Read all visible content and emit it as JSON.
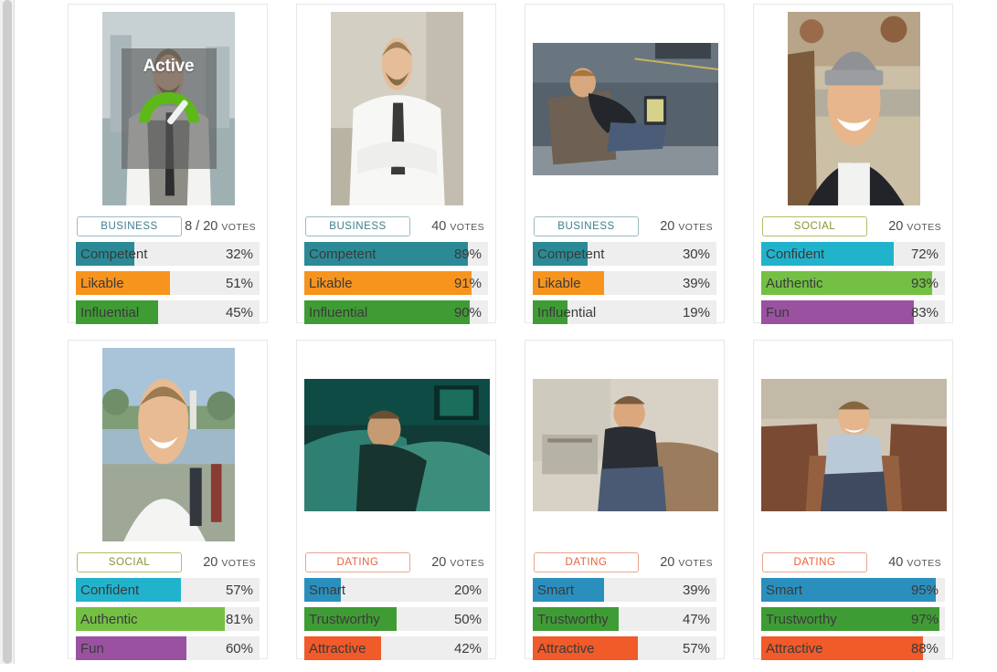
{
  "colors": {
    "business_trait_1": "#2b8a96",
    "business_trait_2": "#f7941e",
    "business_trait_3": "#3f9c35",
    "social_trait_1": "#22b3cc",
    "social_trait_2": "#74c044",
    "social_trait_3": "#9a52a0",
    "dating_trait_1": "#2b8fbd",
    "dating_trait_2": "#3f9c35",
    "dating_trait_3": "#f15a29",
    "track": "#eeeeee",
    "card_border": "#e8e8e8",
    "badge_business": "#3d7f8e",
    "badge_social": "#8a9430",
    "badge_dating": "#e8603c",
    "gauge_arc": "#5cb917",
    "overlay": "rgba(90,90,90,0.62)"
  },
  "cards": [
    {
      "photo": "man-in-vest-and-tie-city-background",
      "orientation": "portrait",
      "active": {
        "label": "Active",
        "icon": "gauge-icon"
      },
      "category": "BUSINESS",
      "category_class": "badge-business",
      "votes": "8 / 20",
      "votes_word": "VOTES",
      "traits": [
        {
          "name": "Competent",
          "pct": 32,
          "value": "32%",
          "color": "#2b8a96"
        },
        {
          "name": "Likable",
          "pct": 51,
          "value": "51%",
          "color": "#f7941e"
        },
        {
          "name": "Influential",
          "pct": 45,
          "value": "45%",
          "color": "#3f9c35"
        }
      ]
    },
    {
      "photo": "man-arms-crossed-white-shirt-tie",
      "orientation": "portrait",
      "active": null,
      "category": "BUSINESS",
      "category_class": "badge-business",
      "votes": "40",
      "votes_word": "VOTES",
      "traits": [
        {
          "name": "Competent",
          "pct": 89,
          "value": "89%",
          "color": "#2b8a96"
        },
        {
          "name": "Likable",
          "pct": 91,
          "value": "91%",
          "color": "#f7941e"
        },
        {
          "name": "Influential",
          "pct": 90,
          "value": "90%",
          "color": "#3f9c35"
        }
      ]
    },
    {
      "photo": "man-on-bench-with-laptop-outdoors",
      "orientation": "landscape",
      "active": null,
      "category": "BUSINESS",
      "category_class": "badge-business",
      "votes": "20",
      "votes_word": "VOTES",
      "traits": [
        {
          "name": "Competent",
          "pct": 30,
          "value": "30%",
          "color": "#2b8a96"
        },
        {
          "name": "Likable",
          "pct": 39,
          "value": "39%",
          "color": "#f7941e"
        },
        {
          "name": "Influential",
          "pct": 19,
          "value": "19%",
          "color": "#3f9c35"
        }
      ]
    },
    {
      "photo": "man-in-gray-beanie-smiling-outdoors",
      "orientation": "portrait",
      "active": null,
      "category": "SOCIAL",
      "category_class": "badge-social",
      "votes": "20",
      "votes_word": "VOTES",
      "traits": [
        {
          "name": "Confident",
          "pct": 72,
          "value": "72%",
          "color": "#22b3cc"
        },
        {
          "name": "Authentic",
          "pct": 93,
          "value": "93%",
          "color": "#74c044"
        },
        {
          "name": "Fun",
          "pct": 83,
          "value": "83%",
          "color": "#9a52a0"
        }
      ]
    },
    {
      "photo": "man-smiling-by-lake-park",
      "orientation": "portrait",
      "active": null,
      "category": "SOCIAL",
      "category_class": "badge-social",
      "votes": "20",
      "votes_word": "VOTES",
      "traits": [
        {
          "name": "Confident",
          "pct": 57,
          "value": "57%",
          "color": "#22b3cc"
        },
        {
          "name": "Authentic",
          "pct": 81,
          "value": "81%",
          "color": "#74c044"
        },
        {
          "name": "Fun",
          "pct": 60,
          "value": "60%",
          "color": "#9a52a0"
        }
      ]
    },
    {
      "photo": "man-on-couch-dim-green-room",
      "orientation": "landscape",
      "active": null,
      "category": "DATING",
      "category_class": "badge-dating",
      "votes": "20",
      "votes_word": "VOTES",
      "traits": [
        {
          "name": "Smart",
          "pct": 20,
          "value": "20%",
          "color": "#2b8fbd"
        },
        {
          "name": "Trustworthy",
          "pct": 50,
          "value": "50%",
          "color": "#3f9c35"
        },
        {
          "name": "Attractive",
          "pct": 42,
          "value": "42%",
          "color": "#f15a29"
        }
      ]
    },
    {
      "photo": "man-seated-in-armchair-living-room",
      "orientation": "landscape",
      "active": null,
      "category": "DATING",
      "category_class": "badge-dating",
      "votes": "20",
      "votes_word": "VOTES",
      "traits": [
        {
          "name": "Smart",
          "pct": 39,
          "value": "39%",
          "color": "#2b8fbd"
        },
        {
          "name": "Trustworthy",
          "pct": 47,
          "value": "47%",
          "color": "#3f9c35"
        },
        {
          "name": "Attractive",
          "pct": 57,
          "value": "57%",
          "color": "#f15a29"
        }
      ]
    },
    {
      "photo": "man-smiling-on-brown-couch",
      "orientation": "landscape",
      "active": null,
      "category": "DATING",
      "category_class": "badge-dating",
      "votes": "40",
      "votes_word": "VOTES",
      "traits": [
        {
          "name": "Smart",
          "pct": 95,
          "value": "95%",
          "color": "#2b8fbd"
        },
        {
          "name": "Trustworthy",
          "pct": 97,
          "value": "97%",
          "color": "#3f9c35"
        },
        {
          "name": "Attractive",
          "pct": 88,
          "value": "88%",
          "color": "#f15a29"
        }
      ]
    }
  ]
}
